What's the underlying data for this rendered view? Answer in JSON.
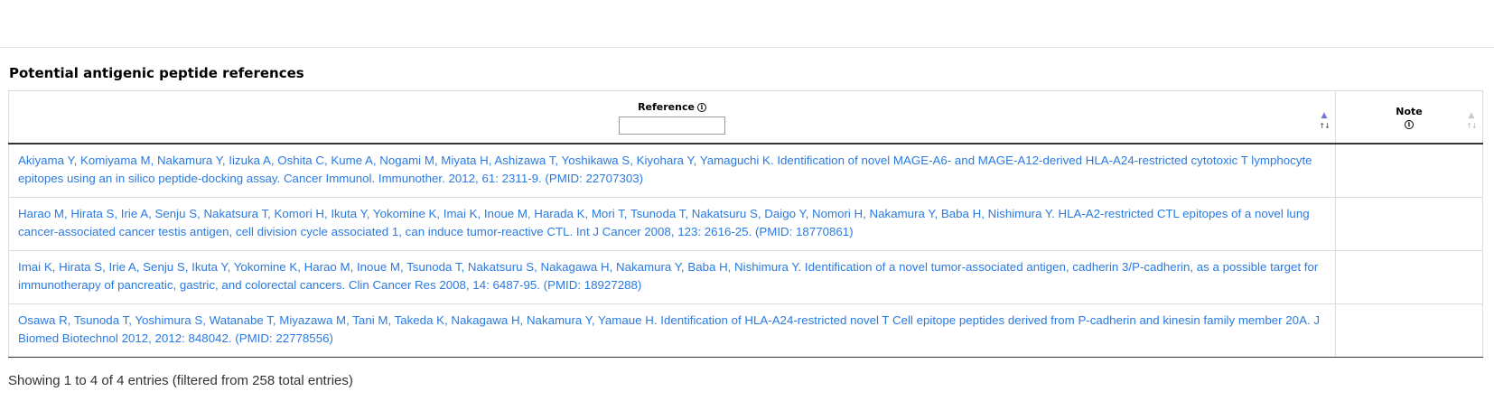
{
  "section": {
    "title": "Potential antigenic peptide references"
  },
  "table": {
    "columns": [
      {
        "label": "Reference",
        "icon": "info-icon",
        "filter_value": "",
        "sort_state": "ascending"
      },
      {
        "label": "Note",
        "icon": "info-icon",
        "sort_state": "none"
      }
    ],
    "rows": [
      {
        "reference": "Akiyama Y, Komiyama M, Nakamura Y, Iizuka A, Oshita C, Kume A, Nogami M, Miyata H, Ashizawa T, Yoshikawa S, Kiyohara Y, Yamaguchi K. Identification of novel MAGE-A6- and MAGE-A12-derived HLA-A24-restricted cytotoxic T lymphocyte epitopes using an in silico peptide-docking assay. Cancer Immunol. Immunother. 2012, 61: 2311-9. (PMID: 22707303)",
        "note": ""
      },
      {
        "reference": "Harao M, Hirata S, Irie A, Senju S, Nakatsura T, Komori H, Ikuta Y, Yokomine K, Imai K, Inoue M, Harada K, Mori T, Tsunoda T, Nakatsuru S, Daigo Y, Nomori H, Nakamura Y, Baba H, Nishimura Y. HLA-A2-restricted CTL epitopes of a novel lung cancer-associated cancer testis antigen, cell division cycle associated 1, can induce tumor-reactive CTL. Int J Cancer 2008, 123: 2616-25. (PMID: 18770861)",
        "note": ""
      },
      {
        "reference": "Imai K, Hirata S, Irie A, Senju S, Ikuta Y, Yokomine K, Harao M, Inoue M, Tsunoda T, Nakatsuru S, Nakagawa H, Nakamura Y, Baba H, Nishimura Y. Identification of a novel tumor-associated antigen, cadherin 3/P-cadherin, as a possible target for immunotherapy of pancreatic, gastric, and colorectal cancers. Clin Cancer Res 2008, 14: 6487-95. (PMID: 18927288)",
        "note": ""
      },
      {
        "reference": "Osawa R, Tsunoda T, Yoshimura S, Watanabe T, Miyazawa M, Tani M, Takeda K, Nakagawa H, Nakamura Y, Yamaue H. Identification of HLA-A24-restricted novel T Cell epitope peptides derived from P-cadherin and kinesin family member 20A. J Biomed Biotechnol 2012, 2012: 848042. (PMID: 22778556)",
        "note": ""
      }
    ]
  },
  "footer": {
    "info": "Showing 1 to 4 of 4 entries (filtered from 258 total entries)"
  },
  "colors": {
    "link": "#2a7ae2",
    "sort_active": "#6f76d8"
  }
}
